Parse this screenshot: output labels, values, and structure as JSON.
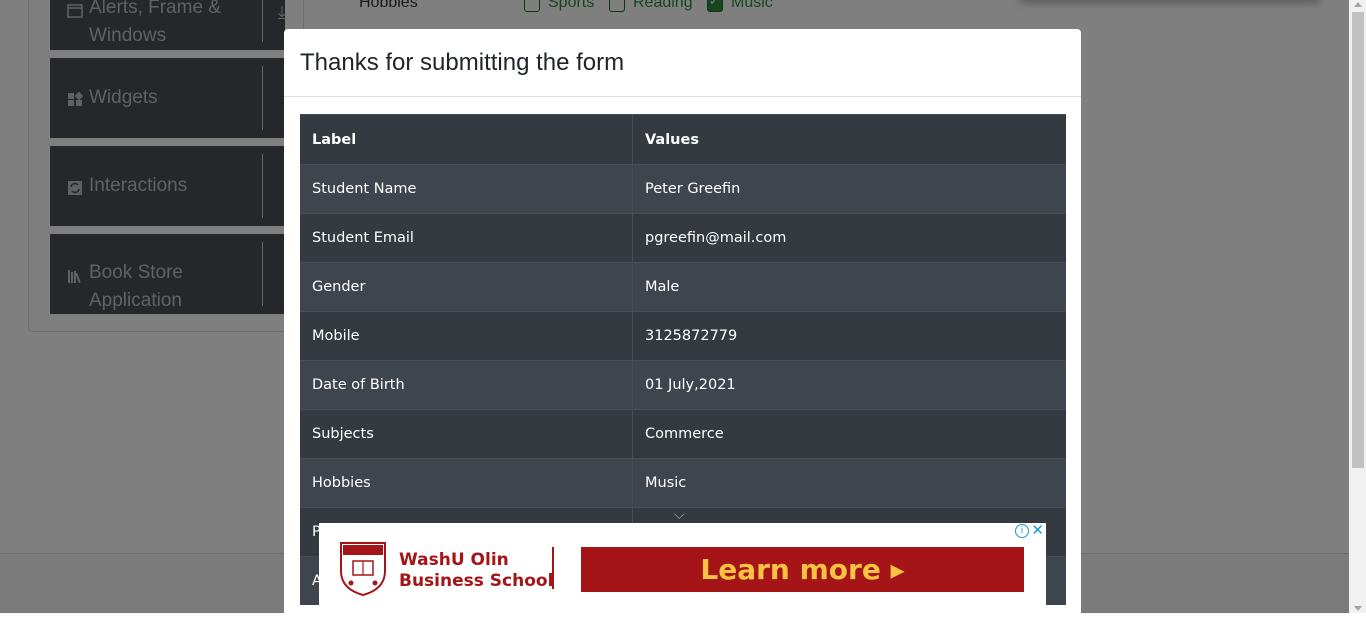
{
  "sidebar": {
    "groups": [
      {
        "label_line1": "Alerts, Frame &",
        "label_line2": "Windows",
        "icon": "window-icon"
      },
      {
        "label": "Widgets",
        "icon": "widgets-icon"
      },
      {
        "label": "Interactions",
        "icon": "interactions-icon"
      },
      {
        "label_line1": "Book Store",
        "label_line2": "Application",
        "icon": "bookstore-icon"
      }
    ]
  },
  "form_bg": {
    "hobbies_label": "Hobbies",
    "hobbies": [
      {
        "label": "Sports",
        "checked": false
      },
      {
        "label": "Reading",
        "checked": false
      },
      {
        "label": "Music",
        "checked": true
      }
    ]
  },
  "modal": {
    "title": "Thanks for submitting the form",
    "headers": {
      "label": "Label",
      "values": "Values"
    },
    "rows": [
      {
        "label": "Student Name",
        "value": "Peter Greefin"
      },
      {
        "label": "Student Email",
        "value": "pgreefin@mail.com"
      },
      {
        "label": "Gender",
        "value": "Male"
      },
      {
        "label": "Mobile",
        "value": "3125872779"
      },
      {
        "label": "Date of Birth",
        "value": "01 July,2021"
      },
      {
        "label": "Subjects",
        "value": "Commerce"
      },
      {
        "label": "Hobbies",
        "value": "Music"
      },
      {
        "label": "P",
        "value": ""
      },
      {
        "label": "A",
        "value": ""
      }
    ]
  },
  "ad": {
    "brand_line1": "WashU Olin",
    "brand_line2": "Business School",
    "cta": "Learn more ▸",
    "info_symbol": "i",
    "close_symbol": "✕",
    "brand_color": "#a51417",
    "cta_text_color": "#f6c343"
  }
}
